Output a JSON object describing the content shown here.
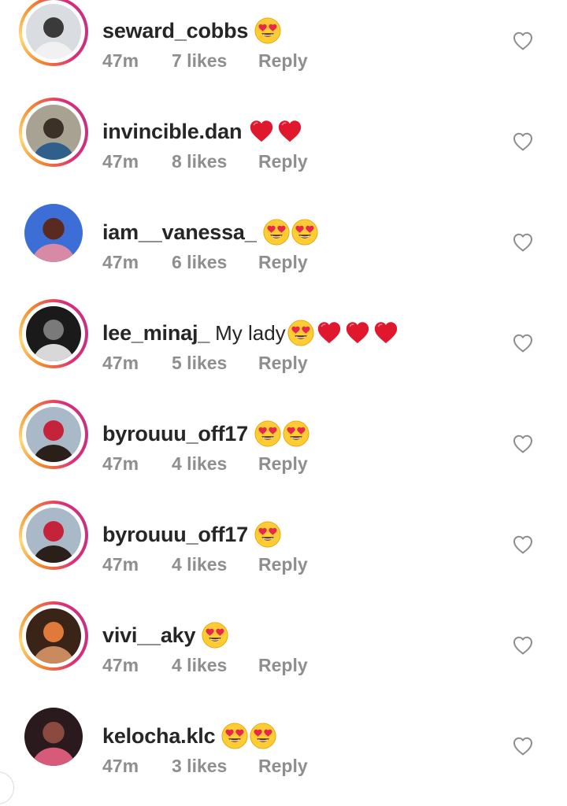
{
  "comments": [
    {
      "username": "seward_cobbs",
      "text": "",
      "emojis": [
        "heart-eyes-emoji"
      ],
      "time": "47m",
      "likes": "7 likes",
      "reply": "Reply",
      "story_ring": true,
      "avatar_colors": [
        "#d9dde2",
        "#f1f1f1",
        "#3a3a3a"
      ]
    },
    {
      "username": "invincible.dan",
      "text": "",
      "emojis": [
        "red-heart-emoji",
        "red-heart-emoji"
      ],
      "time": "47m",
      "likes": "8 likes",
      "reply": "Reply",
      "story_ring": true,
      "avatar_colors": [
        "#a8a293",
        "#2f5f8a",
        "#3c3127"
      ]
    },
    {
      "username": "iam__vanessa_",
      "text": "",
      "emojis": [
        "heart-eyes-emoji",
        "heart-eyes-emoji"
      ],
      "time": "47m",
      "likes": "6 likes",
      "reply": "Reply",
      "story_ring": false,
      "avatar_colors": [
        "#3c6ed6",
        "#d68aa5",
        "#5a2a20"
      ]
    },
    {
      "username": "lee_minaj_",
      "text": "My lady",
      "emojis": [
        "heart-eyes-emoji",
        "red-heart-emoji",
        "red-heart-emoji",
        "red-heart-emoji"
      ],
      "time": "47m",
      "likes": "5 likes",
      "reply": "Reply",
      "story_ring": true,
      "avatar_colors": [
        "#1a1a1a",
        "#d8d8d8",
        "#7a7a7a"
      ]
    },
    {
      "username": "byrouuu_off17",
      "text": "",
      "emojis": [
        "heart-eyes-emoji",
        "heart-eyes-emoji"
      ],
      "time": "47m",
      "likes": "4 likes",
      "reply": "Reply",
      "story_ring": true,
      "avatar_colors": [
        "#a9b9c8",
        "#2b1f1a",
        "#c4233a"
      ]
    },
    {
      "username": "byrouuu_off17",
      "text": "",
      "emojis": [
        "heart-eyes-emoji"
      ],
      "time": "47m",
      "likes": "4 likes",
      "reply": "Reply",
      "story_ring": true,
      "avatar_colors": [
        "#a9b9c8",
        "#2b1f1a",
        "#c4233a"
      ]
    },
    {
      "username": "vivi__aky",
      "text": "",
      "emojis": [
        "heart-eyes-emoji"
      ],
      "time": "47m",
      "likes": "4 likes",
      "reply": "Reply",
      "story_ring": true,
      "avatar_colors": [
        "#3a2418",
        "#c98a60",
        "#e07a3a"
      ]
    },
    {
      "username": "kelocha.klc",
      "text": "",
      "emojis": [
        "heart-eyes-emoji",
        "heart-eyes-emoji"
      ],
      "time": "47m",
      "likes": "3 likes",
      "reply": "Reply",
      "story_ring": false,
      "avatar_colors": [
        "#2a1a1e",
        "#d85a7a",
        "#8a4a40"
      ]
    }
  ],
  "colors": {
    "text_primary": "#262626",
    "text_secondary": "#8e8e8e",
    "heart_red": "#e0182d",
    "emoji_yellow": "#ffcc33"
  }
}
